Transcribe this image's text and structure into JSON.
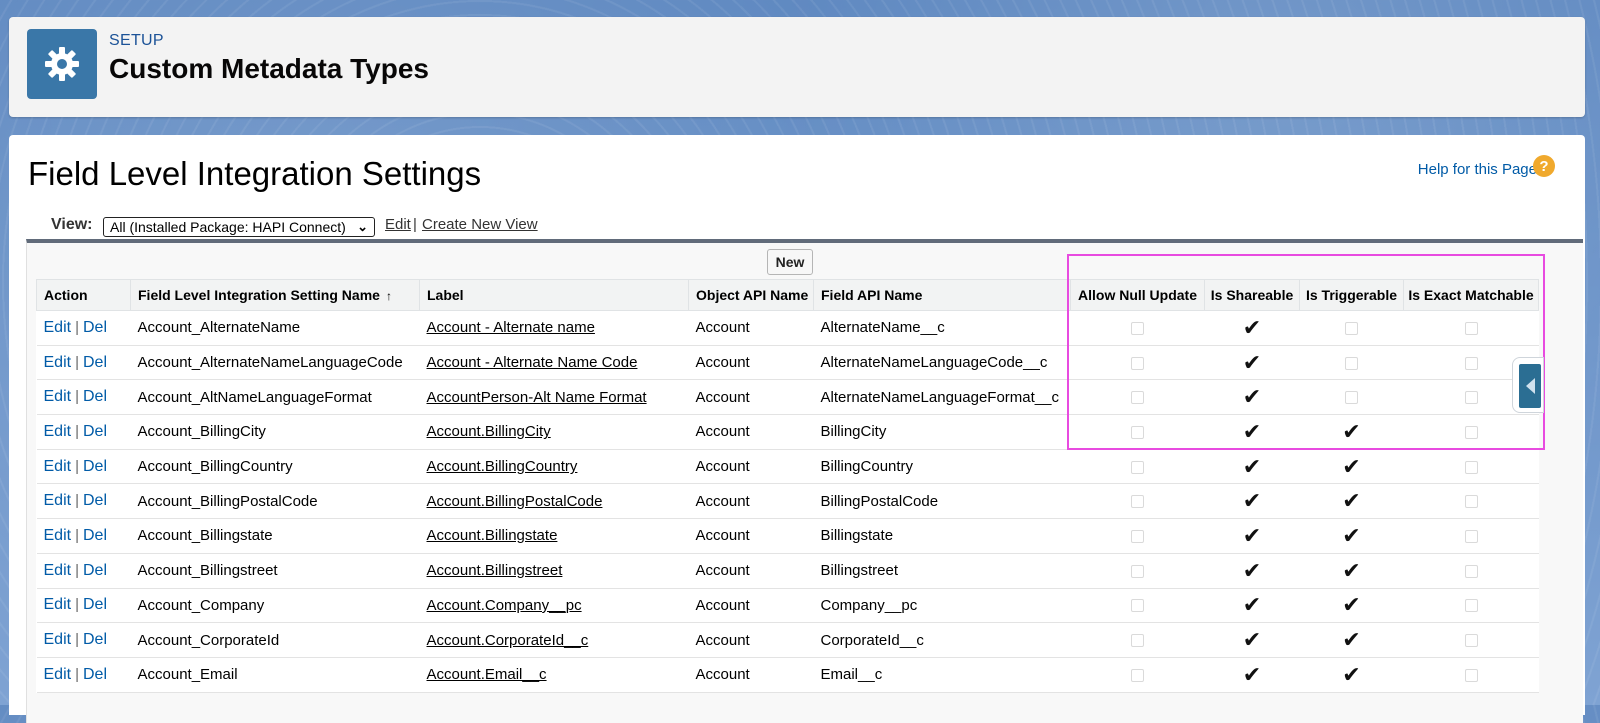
{
  "header": {
    "section": "SETUP",
    "title": "Custom Metadata Types",
    "icon": "gear-icon",
    "icon_color": "#3a77a8"
  },
  "page": {
    "title": "Field Level Integration Settings",
    "help_link": "Help for this Page",
    "help_icon": "?"
  },
  "view": {
    "label": "View:",
    "selected": "All (Installed Package: HAPI Connect)",
    "edit": "Edit",
    "separator": "|",
    "create": "Create New View"
  },
  "list": {
    "new_button": "New",
    "action_edit": "Edit",
    "action_sep": "|",
    "action_del": "Del",
    "checkmark": "✔",
    "sort_indicator": "↑",
    "columns": {
      "action": "Action",
      "name": "Field Level Integration Setting Name",
      "label": "Label",
      "object": "Object API Name",
      "field": "Field API Name",
      "null_update": "Allow Null Update",
      "shareable": "Is Shareable",
      "triggerable": "Is Triggerable",
      "exact": "Is Exact Matchable"
    },
    "rows": [
      {
        "name": "Account_AlternateName",
        "label": "Account - Alternate name",
        "object": "Account",
        "field": "AlternateName__c",
        "null_update": false,
        "shareable": true,
        "triggerable": false,
        "exact": false
      },
      {
        "name": "Account_AlternateNameLanguageCode",
        "label": "Account - Alternate Name Code",
        "object": "Account",
        "field": "AlternateNameLanguageCode__c",
        "null_update": false,
        "shareable": true,
        "triggerable": false,
        "exact": false
      },
      {
        "name": "Account_AltNameLanguageFormat",
        "label": "AccountPerson-Alt Name Format",
        "object": "Account",
        "field": "AlternateNameLanguageFormat__c",
        "null_update": false,
        "shareable": true,
        "triggerable": false,
        "exact": false
      },
      {
        "name": "Account_BillingCity",
        "label": "Account.BillingCity",
        "object": "Account",
        "field": "BillingCity",
        "null_update": false,
        "shareable": true,
        "triggerable": true,
        "exact": false
      },
      {
        "name": "Account_BillingCountry",
        "label": "Account.BillingCountry",
        "object": "Account",
        "field": "BillingCountry",
        "null_update": false,
        "shareable": true,
        "triggerable": true,
        "exact": false
      },
      {
        "name": "Account_BillingPostalCode",
        "label": "Account.BillingPostalCode",
        "object": "Account",
        "field": "BillingPostalCode",
        "null_update": false,
        "shareable": true,
        "triggerable": true,
        "exact": false
      },
      {
        "name": "Account_Billingstate",
        "label": "Account.Billingstate",
        "object": "Account",
        "field": "Billingstate",
        "null_update": false,
        "shareable": true,
        "triggerable": true,
        "exact": false
      },
      {
        "name": "Account_Billingstreet",
        "label": "Account.Billingstreet",
        "object": "Account",
        "field": "Billingstreet",
        "null_update": false,
        "shareable": true,
        "triggerable": true,
        "exact": false
      },
      {
        "name": "Account_Company",
        "label": "Account.Company__pc",
        "object": "Account",
        "field": "Company__pc",
        "null_update": false,
        "shareable": true,
        "triggerable": true,
        "exact": false
      },
      {
        "name": "Account_CorporateId",
        "label": "Account.CorporateId__c",
        "object": "Account",
        "field": "CorporateId__c",
        "null_update": false,
        "shareable": true,
        "triggerable": true,
        "exact": false
      },
      {
        "name": "Account_Email",
        "label": "Account.Email__c",
        "object": "Account",
        "field": "Email__c",
        "null_update": false,
        "shareable": true,
        "triggerable": true,
        "exact": false
      }
    ]
  },
  "colors": {
    "highlight_border": "#e84be0",
    "link": "#015ba7",
    "side_tab": "#2b6e93"
  }
}
